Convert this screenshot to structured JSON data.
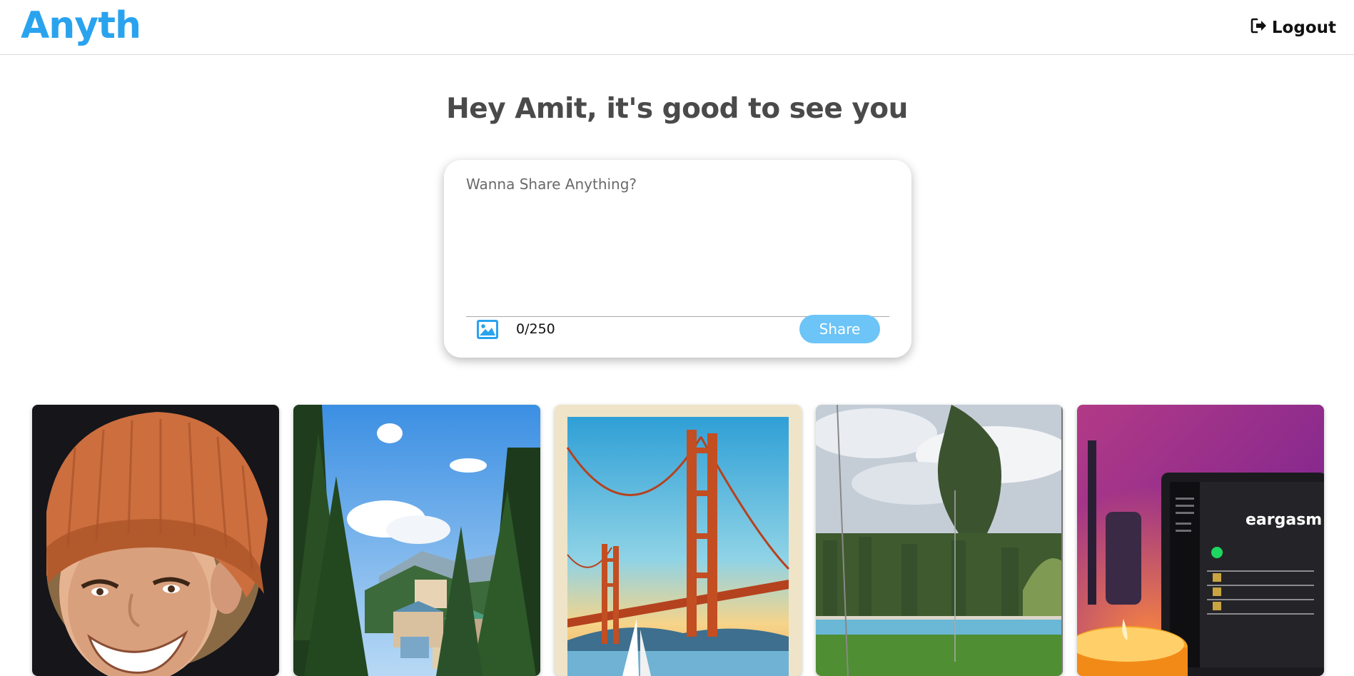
{
  "app": {
    "logo": "Anyth",
    "logout_label": "Logout"
  },
  "greeting": "Hey Amit, it's good to see you",
  "composer": {
    "placeholder": "Wanna Share Anything?",
    "counter": "0/250",
    "share_label": "Share"
  },
  "colors": {
    "brand": "#2aa3ef",
    "share_button": "#6cc4f7",
    "heading": "#4a4a4a"
  },
  "posts": [
    {
      "subject": "portrait-orange-beanie"
    },
    {
      "subject": "mountain-village-forest"
    },
    {
      "subject": "golden-gate-bridge-poster"
    },
    {
      "subject": "garden-pool-hedge"
    },
    {
      "subject": "laptop-music-candle"
    }
  ],
  "laptop_screen": {
    "playlist_title": "eargasm"
  }
}
